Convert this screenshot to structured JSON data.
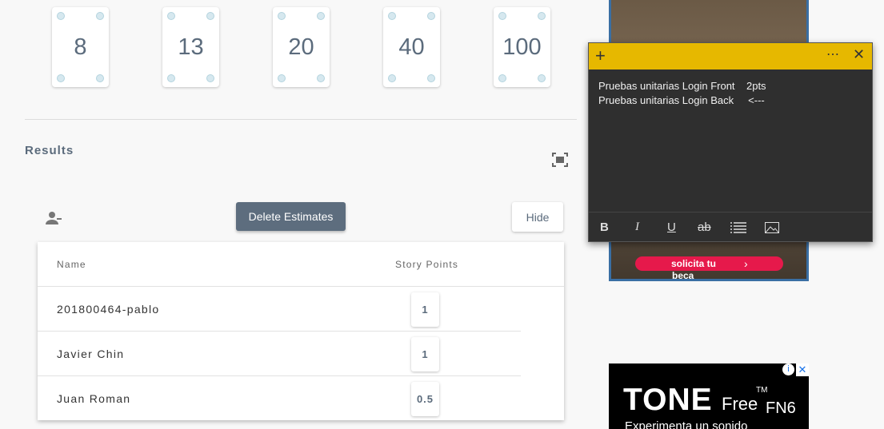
{
  "cards": [
    "8",
    "13",
    "20",
    "40",
    "100"
  ],
  "results": {
    "heading": "Results",
    "delete_label": "Delete Estimates",
    "hide_label": "Hide",
    "columns": {
      "name": "Name",
      "points": "Story Points"
    },
    "rows": [
      {
        "name": "201800464-pablo",
        "points": "1"
      },
      {
        "name": "Javier Chin",
        "points": "1"
      },
      {
        "name": "Juan Roman",
        "points": "0.5"
      }
    ]
  },
  "sticky_note": {
    "line1": "Pruebas unitarias Login Front    2pts",
    "line2": "Pruebas unitarias Login Back     <---",
    "header_color": "#e6b800",
    "toolbar": {
      "bold": "B",
      "italic": "I",
      "underline": "U",
      "strike": "ab"
    }
  },
  "ads": {
    "ad1_cta_line1": "solicita tu",
    "ad1_cta_line2": "beca",
    "ad2_brand": "TONE",
    "ad2_free": "Free",
    "ad2_tm": "TM",
    "ad2_model": "FN6",
    "ad2_tagline": "Experimenta un sonido"
  },
  "colors": {
    "accent": "#5d6d7e",
    "card_value": "#5b6b7c"
  }
}
